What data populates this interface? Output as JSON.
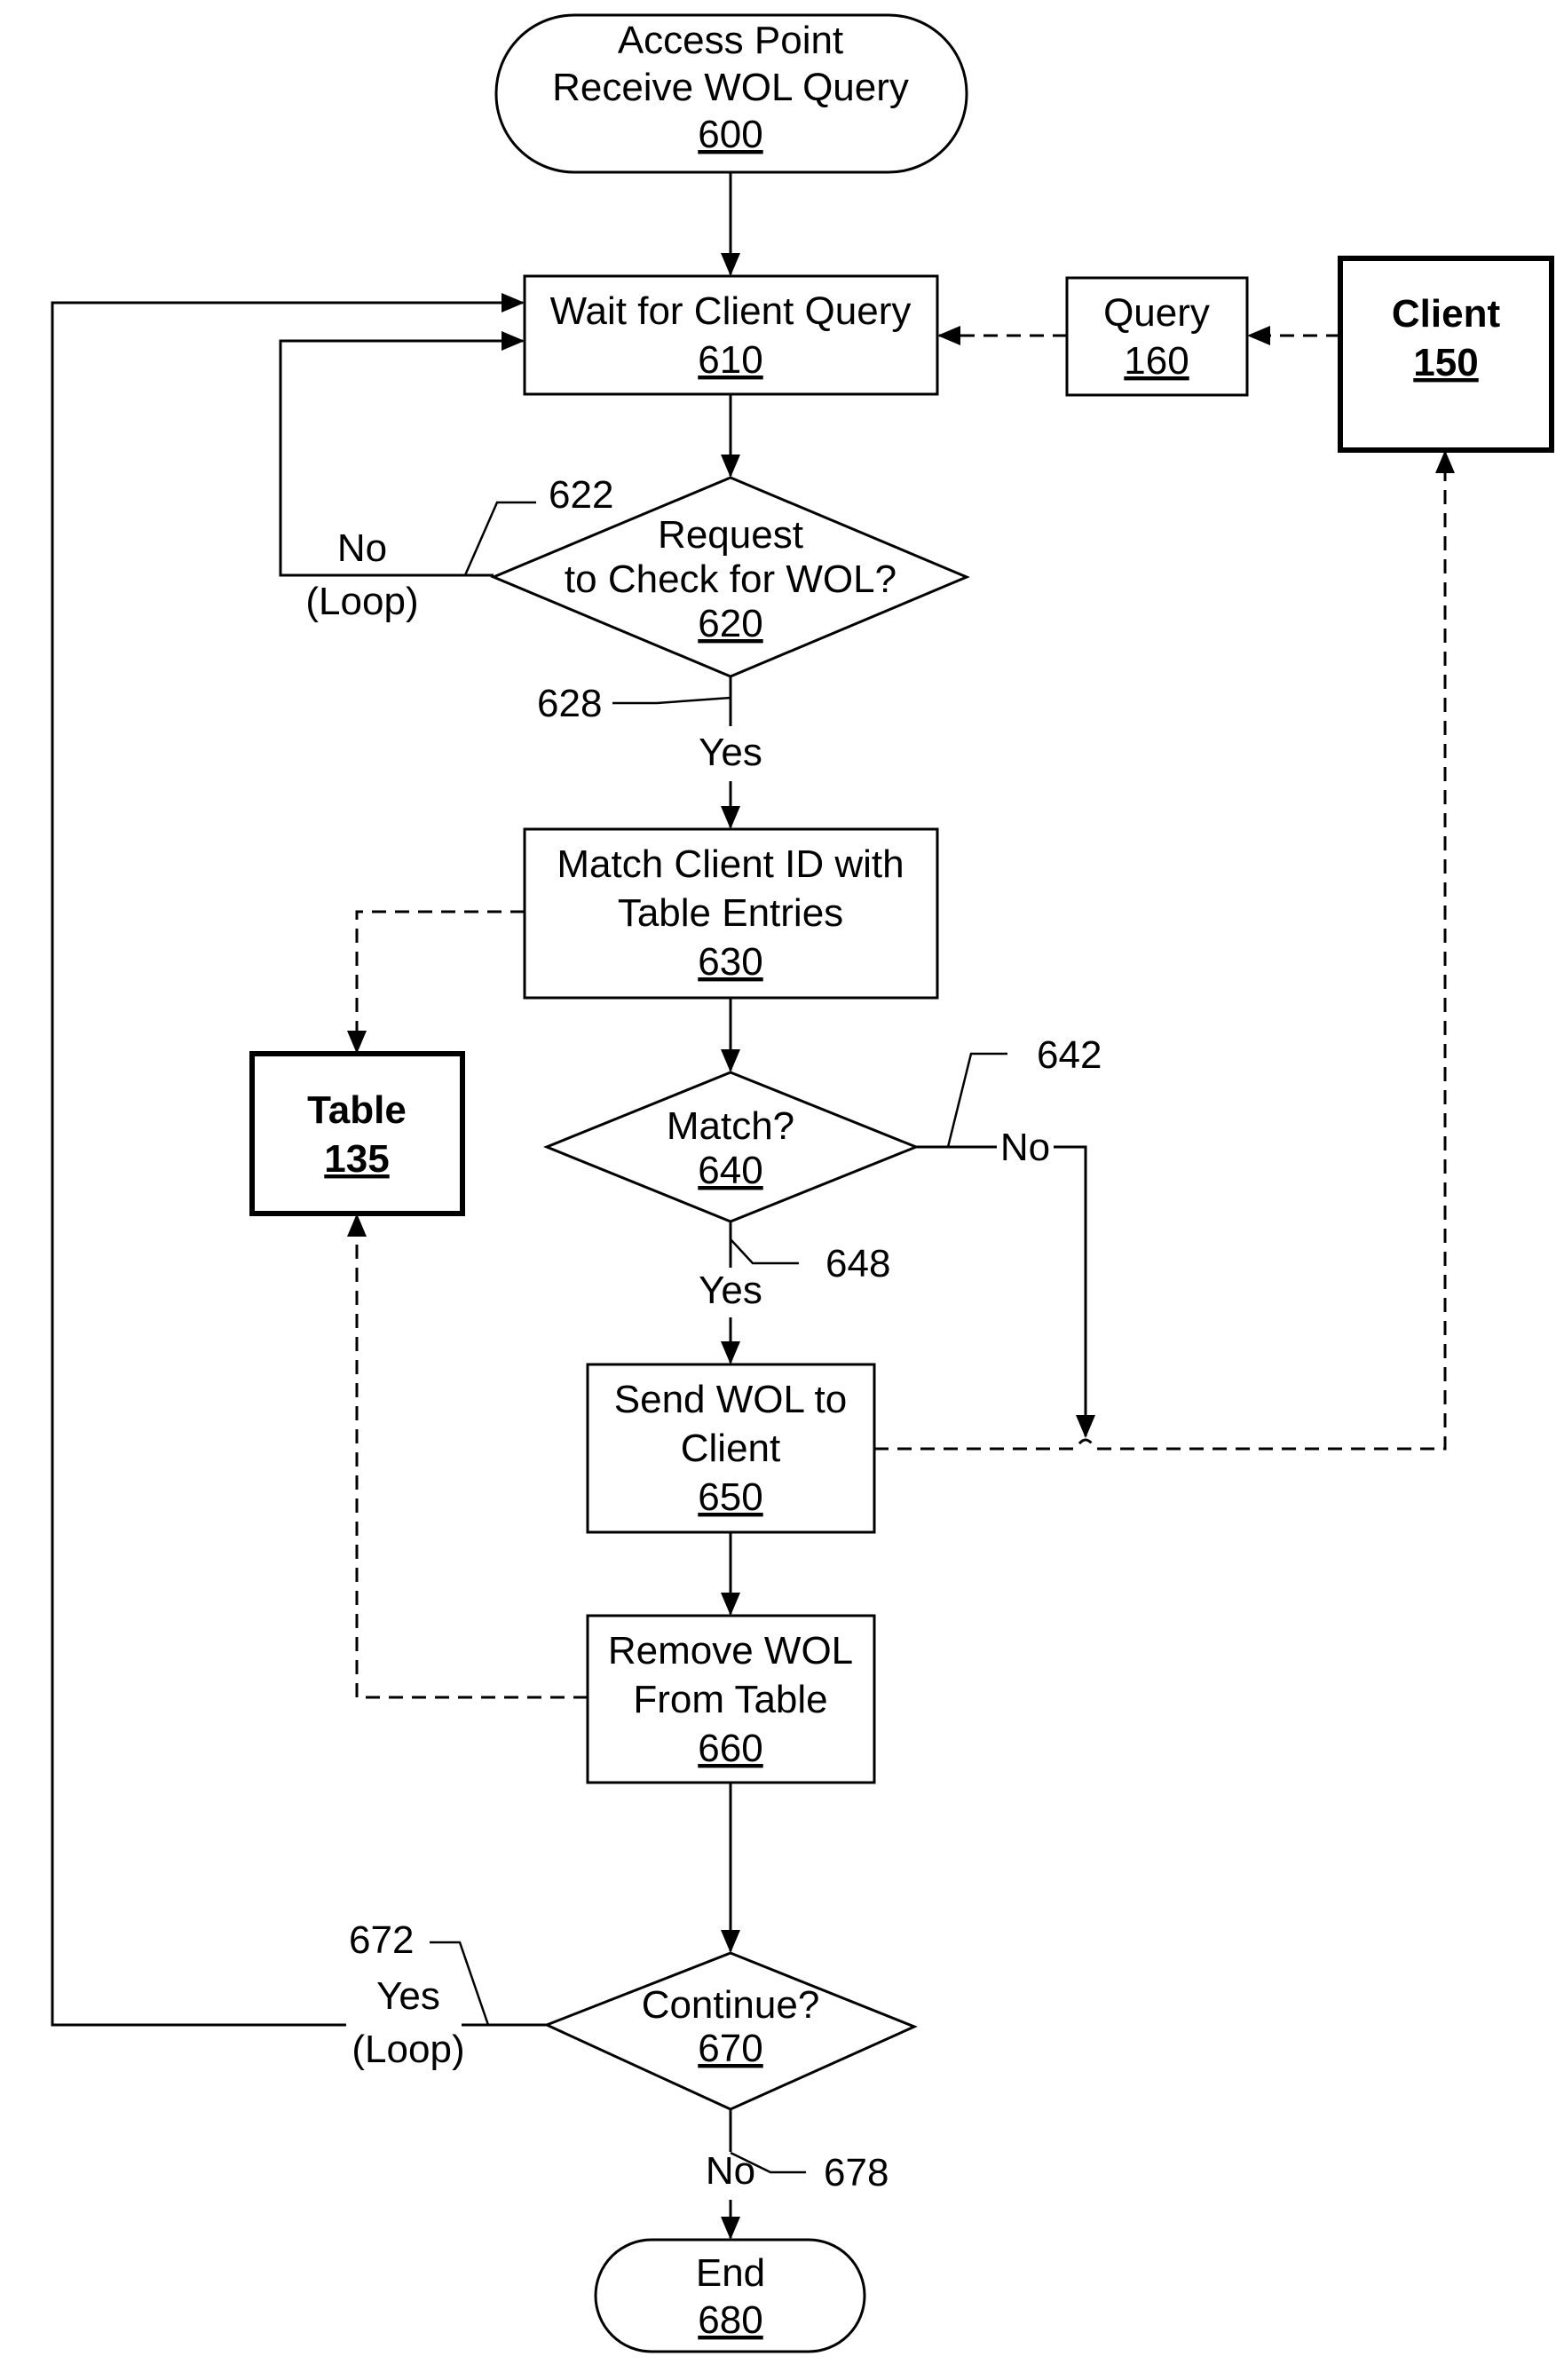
{
  "figure": {
    "type": "flowchart",
    "start": {
      "id": "600",
      "lines": [
        "Access Point",
        "Receive WOL Query"
      ],
      "ref": "600"
    },
    "steps": {
      "wait": {
        "lines": [
          "Wait for Client Query"
        ],
        "ref": "610"
      },
      "request_check": {
        "lines": [
          "Request",
          "to Check for WOL?"
        ],
        "ref": "620"
      },
      "match_client": {
        "lines": [
          "Match Client ID with",
          "Table Entries"
        ],
        "ref": "630"
      },
      "match_decision": {
        "lines": [
          "Match?"
        ],
        "ref": "640"
      },
      "send_wol": {
        "lines": [
          "Send WOL to",
          "Client"
        ],
        "ref": "650"
      },
      "remove_wol": {
        "lines": [
          "Remove WOL",
          "From Table"
        ],
        "ref": "660"
      },
      "continue_decision": {
        "lines": [
          "Continue?"
        ],
        "ref": "670"
      },
      "end": {
        "lines": [
          "End"
        ],
        "ref": "680"
      }
    },
    "external": {
      "query": {
        "lines": [
          "Query"
        ],
        "ref": "160"
      },
      "client": {
        "lines": [
          "Client"
        ],
        "ref": "150"
      },
      "table": {
        "lines": [
          "Table"
        ],
        "ref": "135"
      }
    },
    "branch_labels": {
      "no_loop_620": [
        "No",
        "(Loop)"
      ],
      "yes_620": "Yes",
      "no_640": "No",
      "yes_640": "Yes",
      "yes_loop_670": [
        "Yes",
        "(Loop)"
      ],
      "no_670": "No"
    },
    "callouts": {
      "c622": "622",
      "c628": "628",
      "c642": "642",
      "c648": "648",
      "c672": "672",
      "c678": "678"
    }
  }
}
